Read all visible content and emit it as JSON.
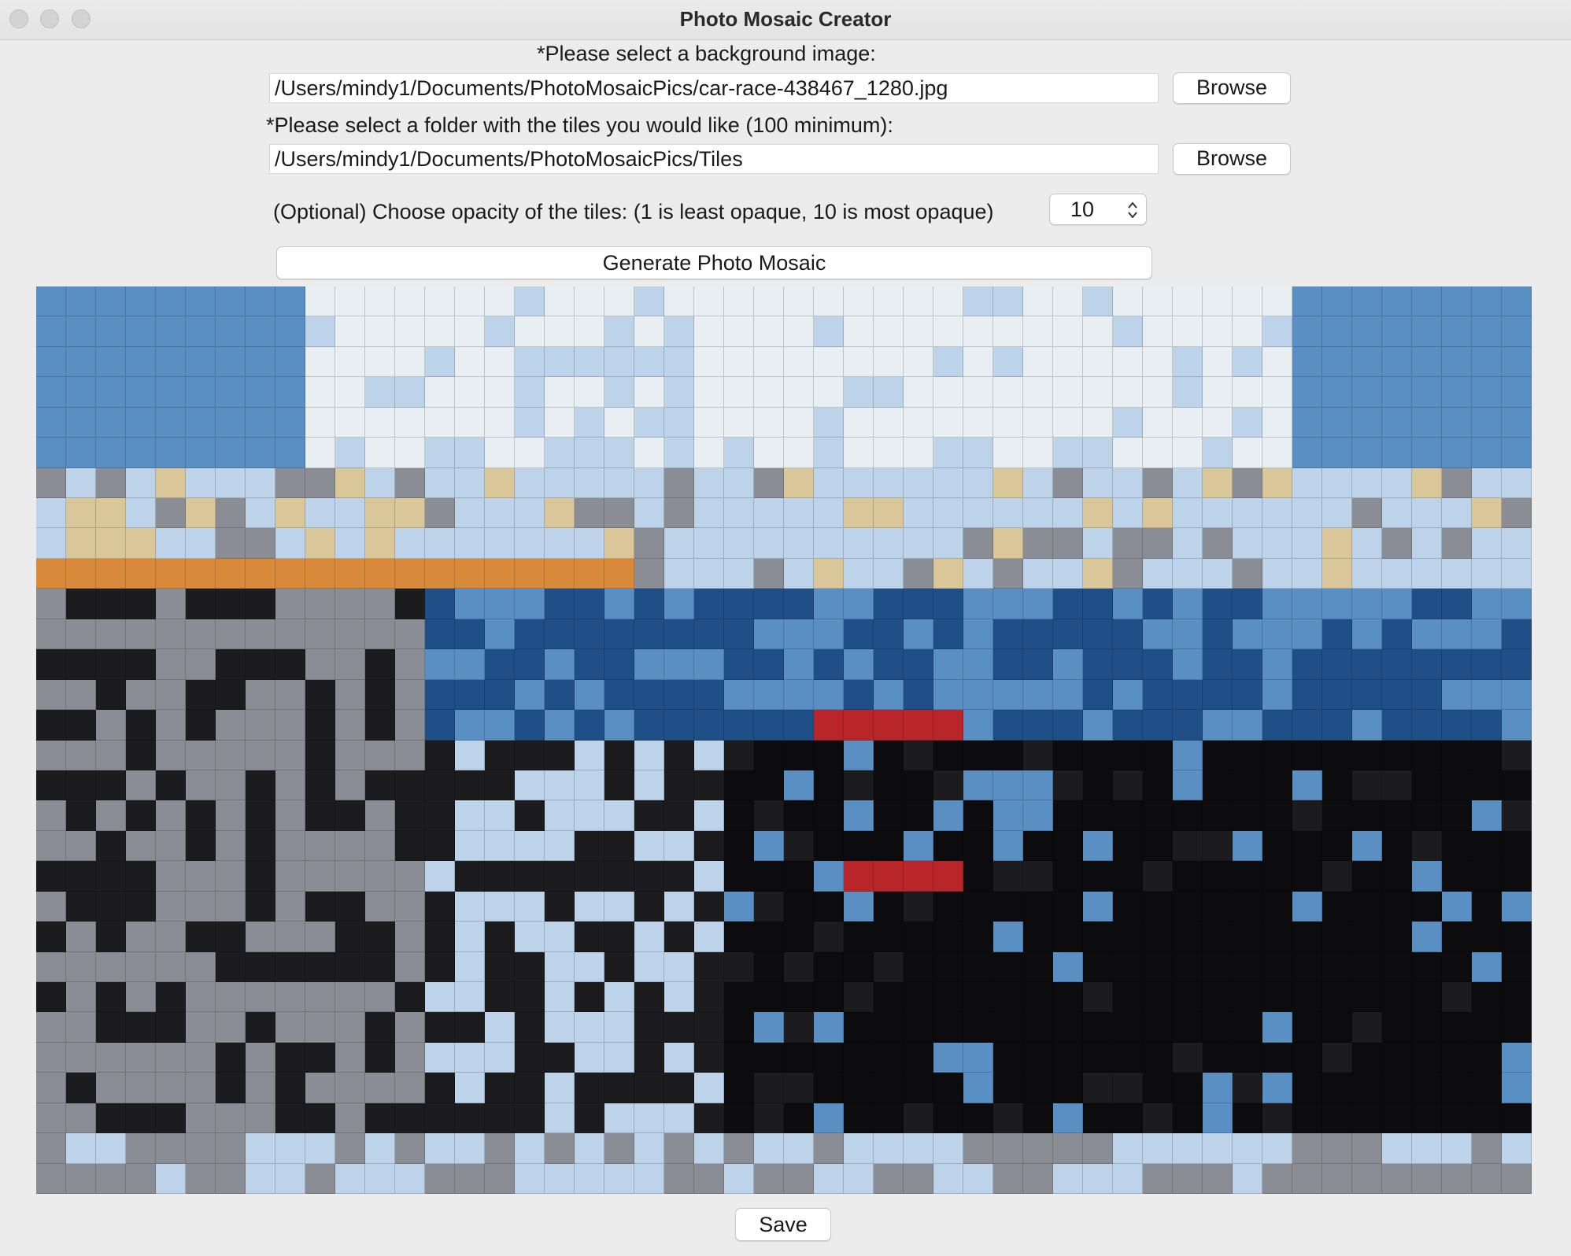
{
  "window": {
    "title": "Photo Mosaic Creator"
  },
  "form": {
    "background_label": "*Please select a background image:",
    "background_path": "/Users/mindy1/Documents/PhotoMosaicPics/car-race-438467_1280.jpg",
    "browse_label": "Browse",
    "tiles_label": "*Please select a folder with the tiles you would like (100 minimum):",
    "tiles_path": "/Users/mindy1/Documents/PhotoMosaicPics/Tiles",
    "opacity_label": "(Optional) Choose opacity of the tiles: (1 is least opaque, 10 is most opaque)",
    "opacity_value": "10",
    "generate_label": "Generate Photo Mosaic",
    "save_label": "Save"
  },
  "mosaic": {
    "cols": 50,
    "rows": 30,
    "palette": {
      "sky": "#5a8fc4",
      "sky_light": "#bcd3ea",
      "white": "#e8eef2",
      "sand": "#d9c79a",
      "orange": "#d88a3a",
      "blue_dark": "#1f4f86",
      "grey": "#8a8d93",
      "dark": "#1c1c1f",
      "black": "#0c0c0e",
      "red": "#b8262a"
    }
  }
}
